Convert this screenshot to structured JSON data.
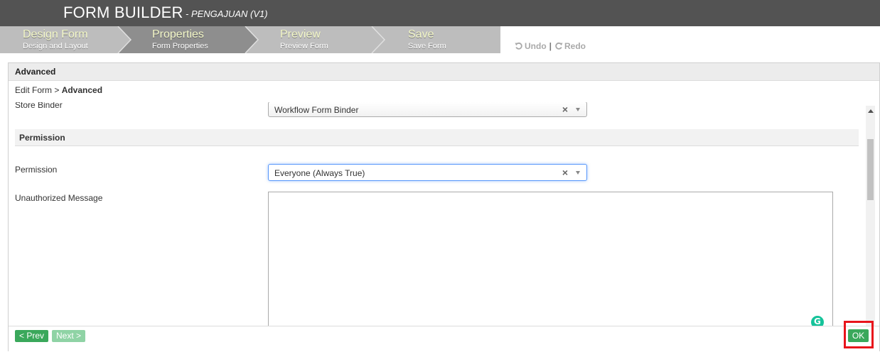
{
  "header": {
    "title": "FORM BUILDER",
    "subtitle": "- PENGAJUAN (V1)"
  },
  "steps": [
    {
      "title": "Design Form",
      "subtitle": "Design and Layout",
      "active": false
    },
    {
      "title": "Properties",
      "subtitle": "Form Properties",
      "active": true
    },
    {
      "title": "Preview",
      "subtitle": "Preview Form",
      "active": false
    },
    {
      "title": "Save",
      "subtitle": "Save Form",
      "active": false
    }
  ],
  "toolbar": {
    "undo_label": "Undo",
    "separator": "|",
    "redo_label": "Redo",
    "undo_icon": "undo-icon",
    "redo_icon": "redo-icon"
  },
  "panel": {
    "title": "Advanced",
    "breadcrumb_prefix": "Edit Form > ",
    "breadcrumb_current": "Advanced"
  },
  "fields": {
    "store_binder_label": "Store Binder",
    "store_binder_value": "Workflow Form Binder",
    "permission_section": "Permission",
    "permission_label": "Permission",
    "permission_value": "Everyone (Always True)",
    "unauthorized_label": "Unauthorized Message",
    "unauthorized_value": "",
    "clear_glyph": "×"
  },
  "footer": {
    "prev_label": "< Prev",
    "next_label": "Next >",
    "ok_label": "OK"
  },
  "colors": {
    "header_bg": "#535353",
    "step_inactive": "#bdbdbd",
    "step_active": "#8e8e8e",
    "accent_green": "#3aa85b",
    "highlight_red": "#e8141b"
  }
}
